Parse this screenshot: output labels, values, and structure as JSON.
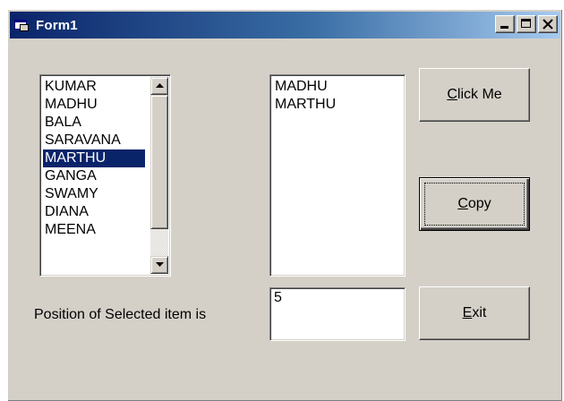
{
  "window": {
    "title": "Form1"
  },
  "list1": {
    "items": [
      "KUMAR",
      "MADHU",
      "BALA",
      "SARAVANA",
      "MARTHU",
      "GANGA",
      "SWAMY",
      "DIANA",
      "MEENA"
    ],
    "selected_item": "MARTHU"
  },
  "list2": {
    "items": [
      "MADHU",
      "MARTHU"
    ]
  },
  "buttons": {
    "click_me": {
      "mnemonic": "C",
      "rest": "lick Me"
    },
    "copy": {
      "mnemonic": "C",
      "rest": "opy"
    },
    "exit": {
      "mnemonic": "E",
      "rest": "xit"
    }
  },
  "position_label": "Position of Selected item is",
  "position_value": "5",
  "colors": {
    "selection": "#0a246a",
    "face": "#d4d0c8",
    "title_start": "#0a246a"
  }
}
